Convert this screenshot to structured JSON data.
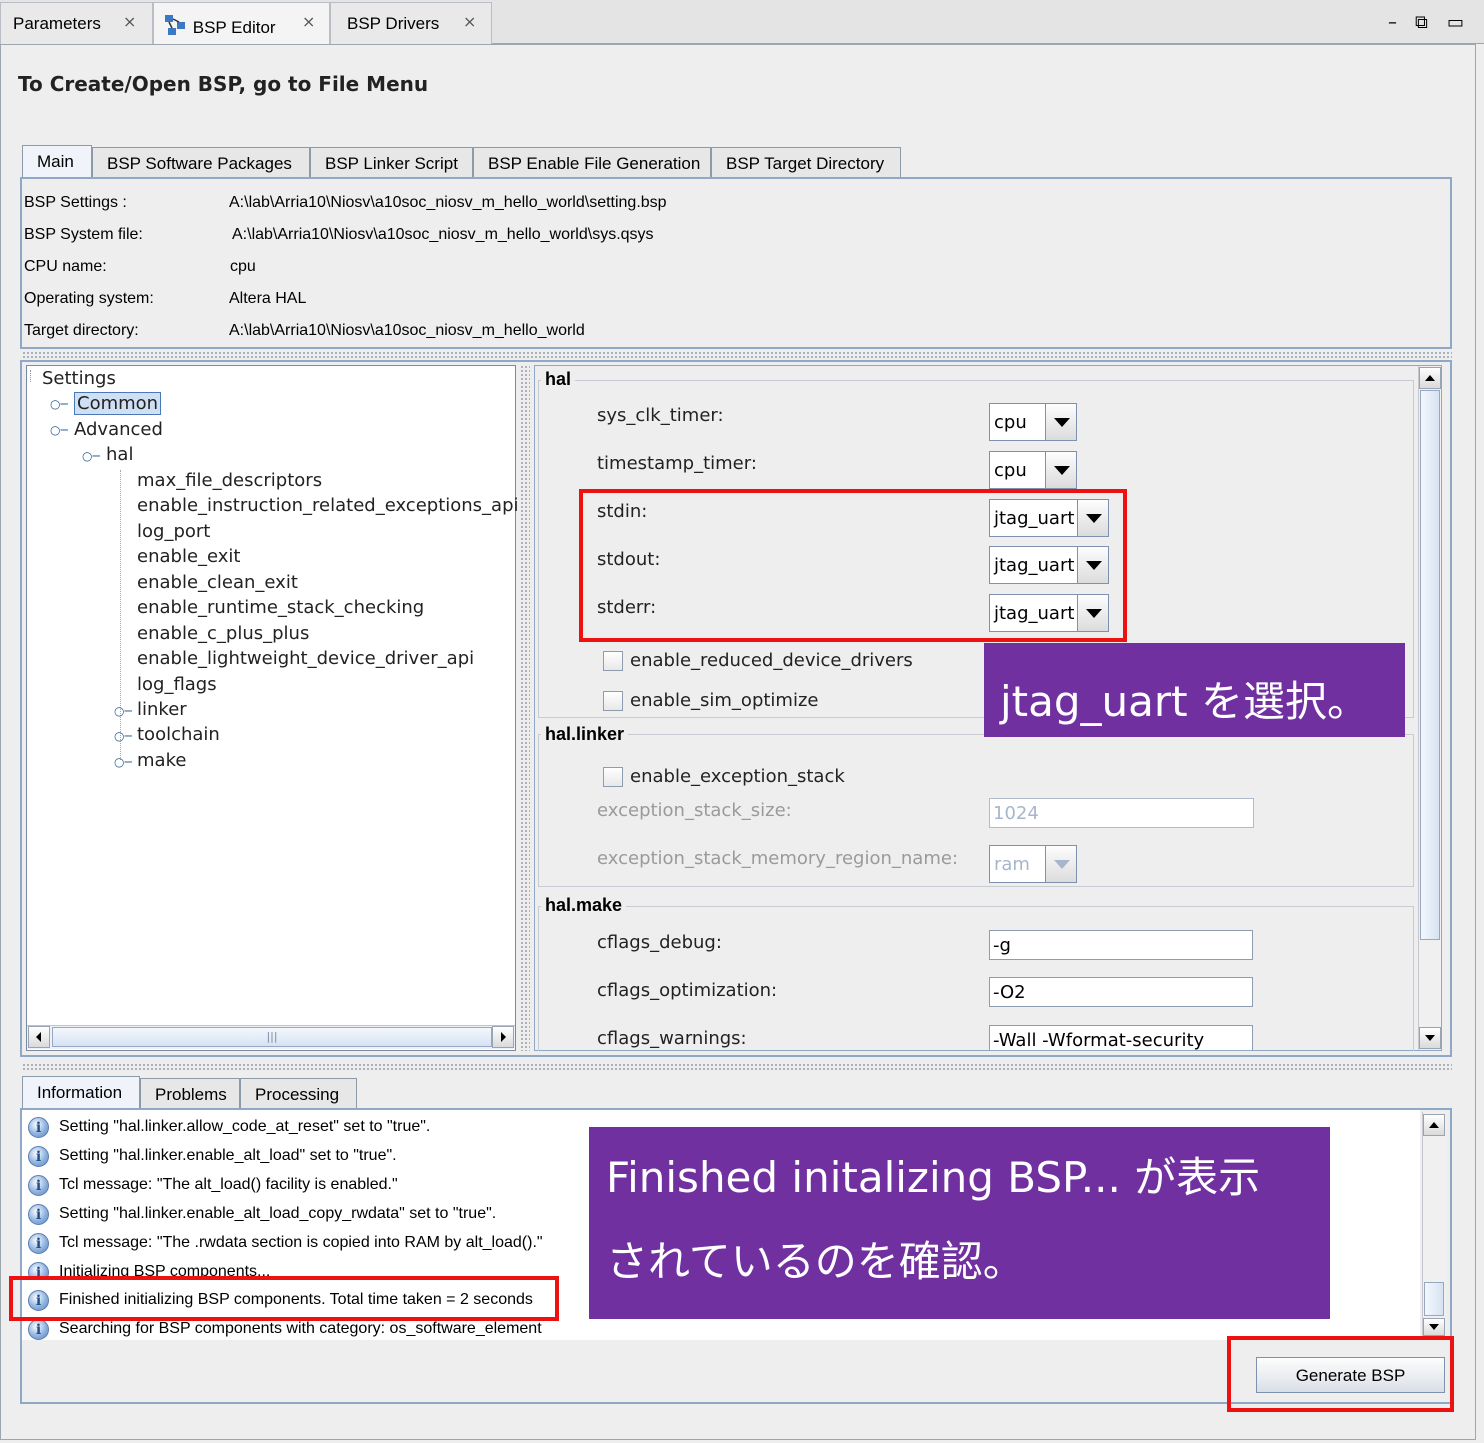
{
  "view_tabs": [
    {
      "label": "Parameters"
    },
    {
      "label": "BSP Editor"
    },
    {
      "label": "BSP Drivers"
    }
  ],
  "window_controls": {
    "minimize": "–",
    "restore": "⧉",
    "maximize": "▭"
  },
  "heading": "To Create/Open BSP, go to File Menu",
  "editor_tabs": [
    "Main",
    "BSP Software Packages",
    "BSP Linker Script",
    "BSP Enable File Generation",
    "BSP Target Directory"
  ],
  "bsp_info": [
    {
      "label": "BSP Settings :",
      "value": "A:\\lab\\Arria10\\Niosv\\a10soc_niosv_m_hello_world\\setting.bsp"
    },
    {
      "label": "BSP System file:",
      "value": "A:\\lab\\Arria10\\Niosv\\a10soc_niosv_m_hello_world\\sys.qsys"
    },
    {
      "label": "CPU name:",
      "value": "cpu"
    },
    {
      "label": "Operating system:",
      "value": "Altera HAL"
    },
    {
      "label": "Target directory:",
      "value": "A:\\lab\\Arria10\\Niosv\\a10soc_niosv_m_hello_world"
    }
  ],
  "tree": {
    "root": "Settings",
    "common": "Common",
    "advanced": "Advanced",
    "hal": "hal",
    "hal_children": [
      "max_file_descriptors",
      "enable_instruction_related_exceptions_api",
      "log_port",
      "enable_exit",
      "enable_clean_exit",
      "enable_runtime_stack_checking",
      "enable_c_plus_plus",
      "enable_lightweight_device_driver_api",
      "log_flags"
    ],
    "groups": [
      "linker",
      "toolchain",
      "make"
    ],
    "hscroll_thumb": "|||"
  },
  "hal": {
    "title": "hal",
    "fields": [
      {
        "label": "sys_clk_timer:",
        "value": "cpu"
      },
      {
        "label": "timestamp_timer:",
        "value": "cpu"
      },
      {
        "label": "stdin:",
        "value": "jtag_uart"
      },
      {
        "label": "stdout:",
        "value": "jtag_uart"
      },
      {
        "label": "stderr:",
        "value": "jtag_uart"
      }
    ],
    "checkboxes": [
      "enable_reduced_device_drivers",
      "enable_sim_optimize"
    ]
  },
  "hal_linker": {
    "title": "hal.linker",
    "checkbox": "enable_exception_stack",
    "stack_size_label": "exception_stack_size:",
    "stack_size_value": "1024",
    "region_label": "exception_stack_memory_region_name:",
    "region_value": "ram"
  },
  "hal_make": {
    "title": "hal.make",
    "fields": [
      {
        "label": "cflags_debug:",
        "value": "-g"
      },
      {
        "label": "cflags_optimization:",
        "value": "-O2"
      },
      {
        "label": "cflags_warnings:",
        "value": "-Wall -Wformat-security"
      }
    ]
  },
  "message_tabs": [
    "Information",
    "Problems",
    "Processing"
  ],
  "messages": [
    "Setting \"hal.linker.allow_code_at_reset\" set to \"true\".",
    "Setting \"hal.linker.enable_alt_load\" set to \"true\".",
    "Tcl message: \"The alt_load() facility is enabled.\"",
    "Setting \"hal.linker.enable_alt_load_copy_rwdata\" set to \"true\".",
    "Tcl message: \"The .rwdata section is copied into RAM by alt_load().\"",
    "Initializing BSP components...",
    "Finished initializing BSP components. Total time taken = 2 seconds",
    "Searching for BSP components with category: os_software_element"
  ],
  "info_icon": "i",
  "generate_button": "Generate BSP",
  "callouts": {
    "jtag": "jtag_uart を選択。",
    "finished_line1": "Finished initalizing BSP... が表示",
    "finished_line2": "されているのを確認。"
  },
  "colors": {
    "callout_bg": "#7030a0",
    "highlight_border": "#ee1111",
    "panel_border": "#8fa8c8"
  }
}
